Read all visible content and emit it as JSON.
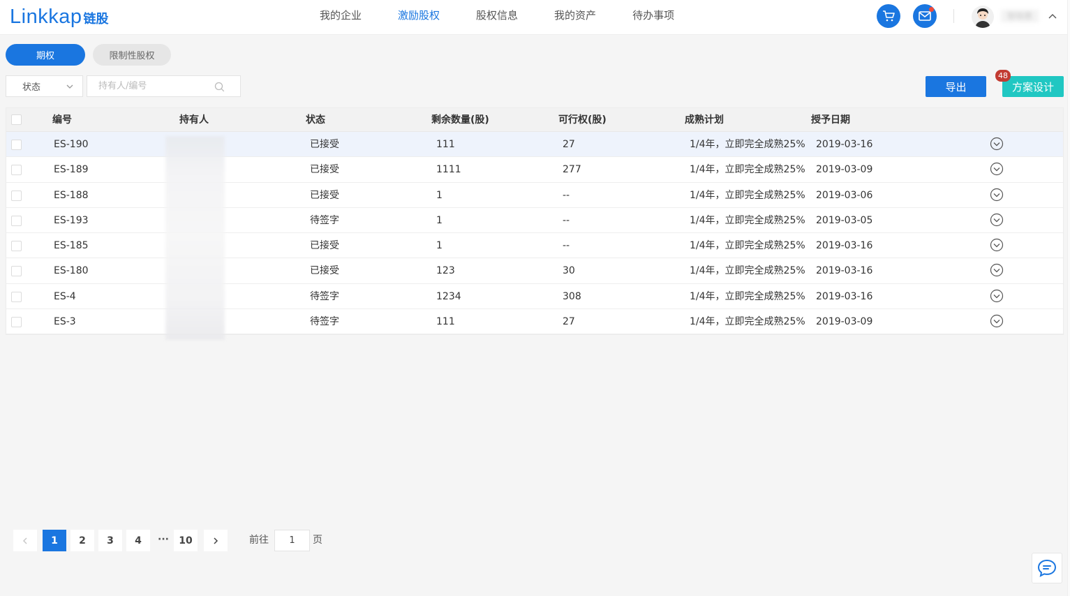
{
  "header": {
    "logo_word": "Linkkap",
    "logo_cn": "链股",
    "nav": [
      "我的企业",
      "激励股权",
      "股权信息",
      "我的资产",
      "待办事项"
    ],
    "nav_active_index": 1,
    "username": "黎晓惠"
  },
  "tabs": {
    "option": "期权",
    "restricted": "限制性股权"
  },
  "filters": {
    "status_label": "状态",
    "search_placeholder": "持有人/编号"
  },
  "actions": {
    "export": "导出",
    "plan_design": "方案设计",
    "badge_count": "48"
  },
  "table": {
    "columns": [
      "编号",
      "持有人",
      "状态",
      "剩余数量(股)",
      "可行权(股)",
      "成熟计划",
      "授予日期"
    ],
    "rows": [
      {
        "id": "ES-190",
        "holder": "",
        "status": "已接受",
        "remaining": "111",
        "exercisable": "27",
        "plan": "1/4年，立即完全成熟25%",
        "date": "2019-03-16"
      },
      {
        "id": "ES-189",
        "holder": "",
        "status": "已接受",
        "remaining": "1111",
        "exercisable": "277",
        "plan": "1/4年，立即完全成熟25%",
        "date": "2019-03-09"
      },
      {
        "id": "ES-188",
        "holder": "",
        "status": "已接受",
        "remaining": "1",
        "exercisable": "--",
        "plan": "1/4年，立即完全成熟25%",
        "date": "2019-03-06"
      },
      {
        "id": "ES-193",
        "holder": "",
        "status": "待签字",
        "remaining": "1",
        "exercisable": "--",
        "plan": "1/4年，立即完全成熟25%",
        "date": "2019-03-05"
      },
      {
        "id": "ES-185",
        "holder": "",
        "status": "已接受",
        "remaining": "1",
        "exercisable": "--",
        "plan": "1/4年，立即完全成熟25%",
        "date": "2019-03-16"
      },
      {
        "id": "ES-180",
        "holder": "",
        "status": "已接受",
        "remaining": "123",
        "exercisable": "30",
        "plan": "1/4年，立即完全成熟25%",
        "date": "2019-03-16"
      },
      {
        "id": "ES-4",
        "holder": "",
        "status": "待签字",
        "remaining": "1234",
        "exercisable": "308",
        "plan": "1/4年，立即完全成熟25%",
        "date": "2019-03-16"
      },
      {
        "id": "ES-3",
        "holder": "",
        "status": "待签字",
        "remaining": "111",
        "exercisable": "27",
        "plan": "1/4年，立即完全成熟25%",
        "date": "2019-03-09"
      }
    ]
  },
  "pagination": {
    "pages": [
      "1",
      "2",
      "3",
      "4"
    ],
    "ellipsis": "···",
    "last": "10",
    "current": "1",
    "goto_label": "前往",
    "goto_value": "1",
    "page_suffix": "页"
  },
  "colors": {
    "primary": "#1a76e0",
    "teal": "#20c7c2",
    "badge": "#c23b32"
  },
  "icons": [
    "cart-icon",
    "mail-icon",
    "chevron-up-icon",
    "chevron-down-icon",
    "search-icon",
    "expand-circle-icon",
    "chat-icon",
    "prev-icon",
    "next-icon"
  ]
}
